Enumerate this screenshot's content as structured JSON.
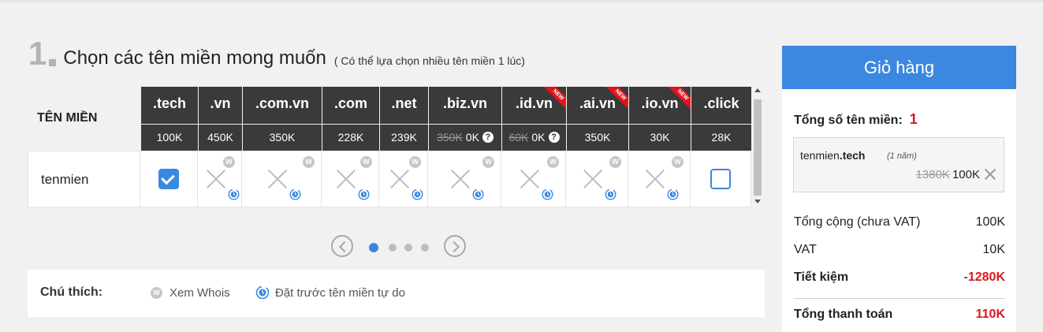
{
  "step": {
    "number": "1",
    "title": "Chọn các tên miền mong muốn",
    "subtitle": "( Có thể lựa chọn nhiều tên miền 1 lúc)"
  },
  "table": {
    "label_header": "TÊN MIỀN",
    "domain": "tenmien",
    "extensions": [
      {
        "name": ".tech",
        "price": "100K",
        "old_price": null,
        "selected": true,
        "available": true,
        "is_new": false
      },
      {
        "name": ".vn",
        "price": "450K",
        "old_price": null,
        "selected": false,
        "available": false,
        "is_new": false
      },
      {
        "name": ".com.vn",
        "price": "350K",
        "old_price": null,
        "selected": false,
        "available": false,
        "is_new": false
      },
      {
        "name": ".com",
        "price": "228K",
        "old_price": null,
        "selected": false,
        "available": false,
        "is_new": false
      },
      {
        "name": ".net",
        "price": "239K",
        "old_price": null,
        "selected": false,
        "available": false,
        "is_new": false
      },
      {
        "name": ".biz.vn",
        "price": "0K",
        "old_price": "350K",
        "selected": false,
        "available": false,
        "is_new": false
      },
      {
        "name": ".id.vn",
        "price": "0K",
        "old_price": "60K",
        "selected": false,
        "available": false,
        "is_new": true
      },
      {
        "name": ".ai.vn",
        "price": "350K",
        "old_price": null,
        "selected": false,
        "available": false,
        "is_new": true
      },
      {
        "name": ".io.vn",
        "price": "30K",
        "old_price": null,
        "selected": false,
        "available": false,
        "is_new": true
      },
      {
        "name": ".click",
        "price": "28K",
        "old_price": null,
        "selected": false,
        "available": true,
        "is_new": false
      }
    ],
    "whois_badge": "W",
    "new_badge": "NEW",
    "info_mark": "?"
  },
  "pagination": {
    "pages": 4,
    "active": 1
  },
  "legend": {
    "title": "Chú thích:",
    "whois_label": "Xem Whois",
    "preorder_label": "Đặt trước tên miền tự do"
  },
  "cart": {
    "title": "Giỏ hàng",
    "count_label": "Tổng số tên miền:",
    "count": "1",
    "item": {
      "name_prefix": "tenmien",
      "name_ext": ".tech",
      "term": "(1 năm)",
      "old_price": "1380K",
      "price": "100K"
    },
    "subtotal_label": "Tổng cộng (chưa VAT)",
    "subtotal": "100K",
    "vat_label": "VAT",
    "vat": "10K",
    "saving_label": "Tiết kiệm",
    "saving": "-1280K",
    "total_label": "Tổng thanh toán",
    "total": "110K"
  },
  "colors": {
    "accent": "#3c87e0",
    "header_dark": "#3a3a3a",
    "price_red": "#d71920",
    "badge_grey": "#c6c6c6",
    "ribbon_red": "#e2141b"
  },
  "icons": {
    "checkbox": "checkbox-icon",
    "unavailable": "x-icon",
    "whois": "whois-icon",
    "preorder": "clock-icon",
    "remove": "close-icon",
    "prev": "chevron-left-icon",
    "next": "chevron-right-icon"
  }
}
